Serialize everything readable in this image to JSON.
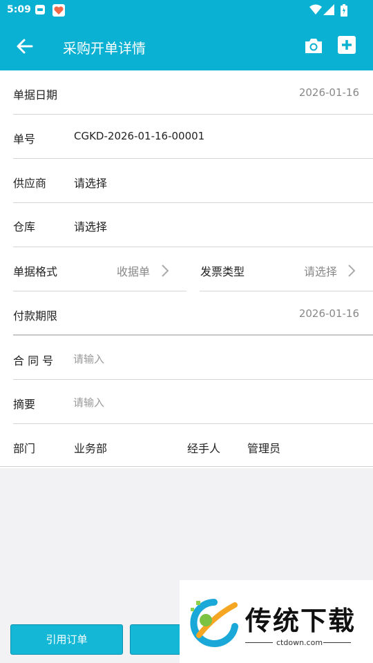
{
  "status_bar": {
    "time": "5:09"
  },
  "header": {
    "title": "采购开单详情"
  },
  "form": {
    "doc_date": {
      "label": "单据日期",
      "value": "2026-01-16"
    },
    "doc_no": {
      "label": "单号",
      "value": "CGKD-2026-01-16-00001"
    },
    "supplier": {
      "label": "供应商",
      "value": "请选择"
    },
    "warehouse": {
      "label": "仓库",
      "value": "请选择"
    },
    "doc_format": {
      "label": "单据格式",
      "value": "收据单"
    },
    "invoice_type": {
      "label": "发票类型",
      "value": "请选择"
    },
    "payment_due": {
      "label": "付款期限",
      "value": "2026-01-16"
    },
    "contract_no": {
      "label": "合 同 号",
      "placeholder": "请输入"
    },
    "summary": {
      "label": "摘要",
      "placeholder": "请输入"
    },
    "department": {
      "label": "部门",
      "value": "业务部"
    },
    "handler": {
      "label": "经手人",
      "value": "管理员"
    }
  },
  "buttons": {
    "ref_order": "引用订单",
    "second_partial": ""
  },
  "watermark": {
    "text": "传统下载",
    "url": "ctdown.com"
  },
  "colors": {
    "primary": "#0bb1d2",
    "button": "#14b8d6"
  }
}
